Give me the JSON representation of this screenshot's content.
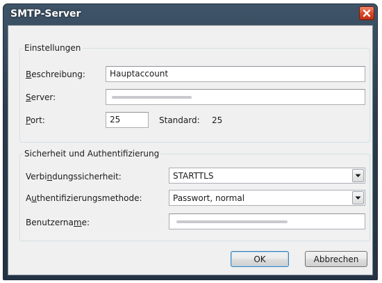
{
  "window": {
    "title": "SMTP-Server",
    "close_icon": "close-icon"
  },
  "settings": {
    "legend": "Einstellungen",
    "description_label_accel": "B",
    "description_label_rest": "eschreibung:",
    "description_value": "Hauptaccount",
    "server_label_accel": "S",
    "server_label_rest": "erver:",
    "port_label_accel": "P",
    "port_label_rest": "ort:",
    "port_value": "25",
    "default_label": "Standard:",
    "default_value": "25"
  },
  "security": {
    "legend": "Sicherheit und Authentifizierung",
    "connection_label_pre": "Verbi",
    "connection_label_accel": "n",
    "connection_label_post": "dungssicherheit:",
    "connection_value": "STARTTLS",
    "auth_label_pre": "A",
    "auth_label_accel": "u",
    "auth_label_post": "thentifizierungsmethode:",
    "auth_value": "Passwort, normal",
    "username_label_pre": "Benutzerna",
    "username_label_accel": "m",
    "username_label_post": "e:"
  },
  "buttons": {
    "ok": "OK",
    "cancel": "Abbrechen"
  },
  "colors": {
    "title_bar": "#2a3b4d",
    "close_button": "#d9492b",
    "dialog_bg": "#f0f0f0"
  }
}
